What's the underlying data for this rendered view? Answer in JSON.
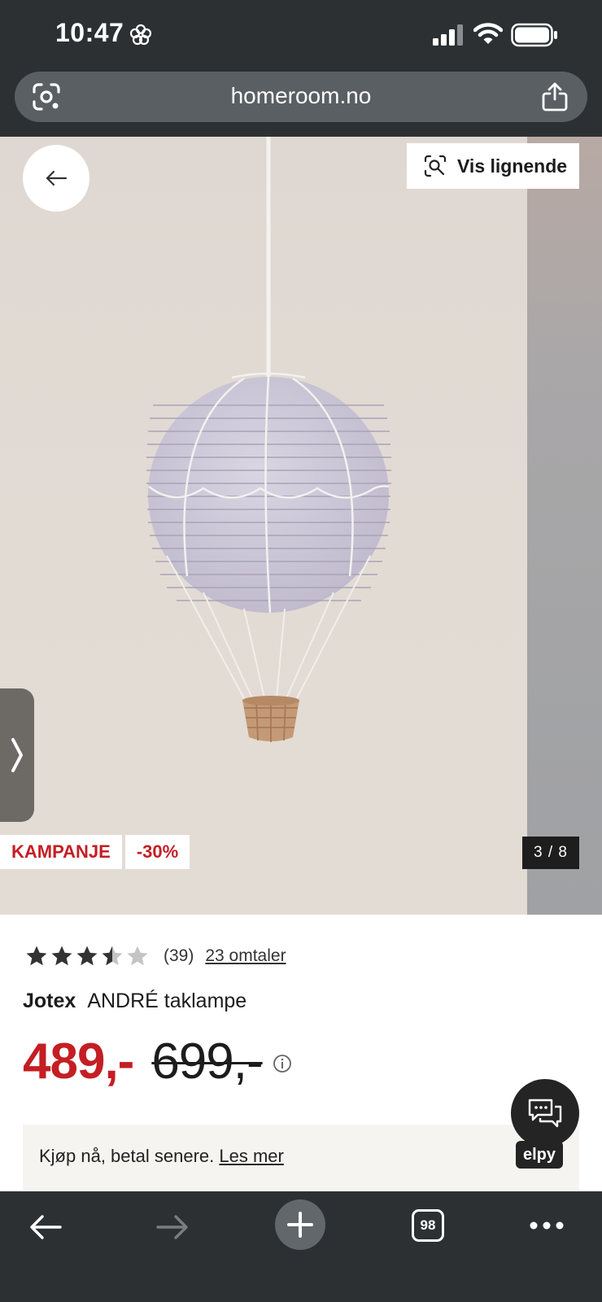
{
  "status_bar": {
    "time": "10:47"
  },
  "browser": {
    "url": "homeroom.no",
    "tab_count": "98"
  },
  "product_image": {
    "similar_button_label": "Vis lignende",
    "badges": [
      "KAMPANJE",
      "-30%"
    ],
    "counter": "3 / 8"
  },
  "product": {
    "rating": 3.5,
    "rating_count": "(39)",
    "reviews_label": "23 omtaler",
    "brand": "Jotex",
    "name": "ANDRÉ taklampe",
    "price_now": "489,-",
    "price_old": "699,-"
  },
  "pay_later": {
    "text": "Kjøp nå, betal senere.",
    "link": "Les mer"
  },
  "chat": {
    "brand": "elpy"
  },
  "colors": {
    "accent_red": "#c41e24",
    "chrome": "#2d3033"
  }
}
